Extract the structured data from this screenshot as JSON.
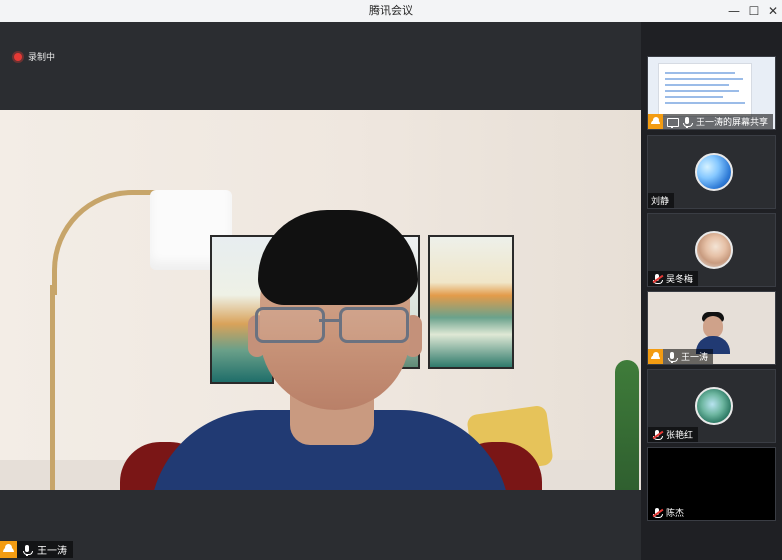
{
  "window": {
    "title": "腾讯会议",
    "controls": {
      "minimize": "—",
      "maximize": "☐",
      "close": "✕"
    }
  },
  "recording": {
    "text": "录制中",
    "icon": "recording-dot-icon"
  },
  "main": {
    "active_speaker": "王一涛"
  },
  "sidebar": {
    "tiles": [
      {
        "label": "王一涛的屏幕共享",
        "kind": "screen-share"
      },
      {
        "label": "刘静",
        "kind": "avatar"
      },
      {
        "label": "吴冬梅",
        "kind": "avatar"
      },
      {
        "label": "王一涛",
        "kind": "video"
      },
      {
        "label": "张艳红",
        "kind": "avatar"
      },
      {
        "label": "陈杰",
        "kind": "blank"
      }
    ]
  },
  "colors": {
    "accent": "#f39c12",
    "record": "#e53935",
    "dark_bg": "#2b2d31"
  }
}
